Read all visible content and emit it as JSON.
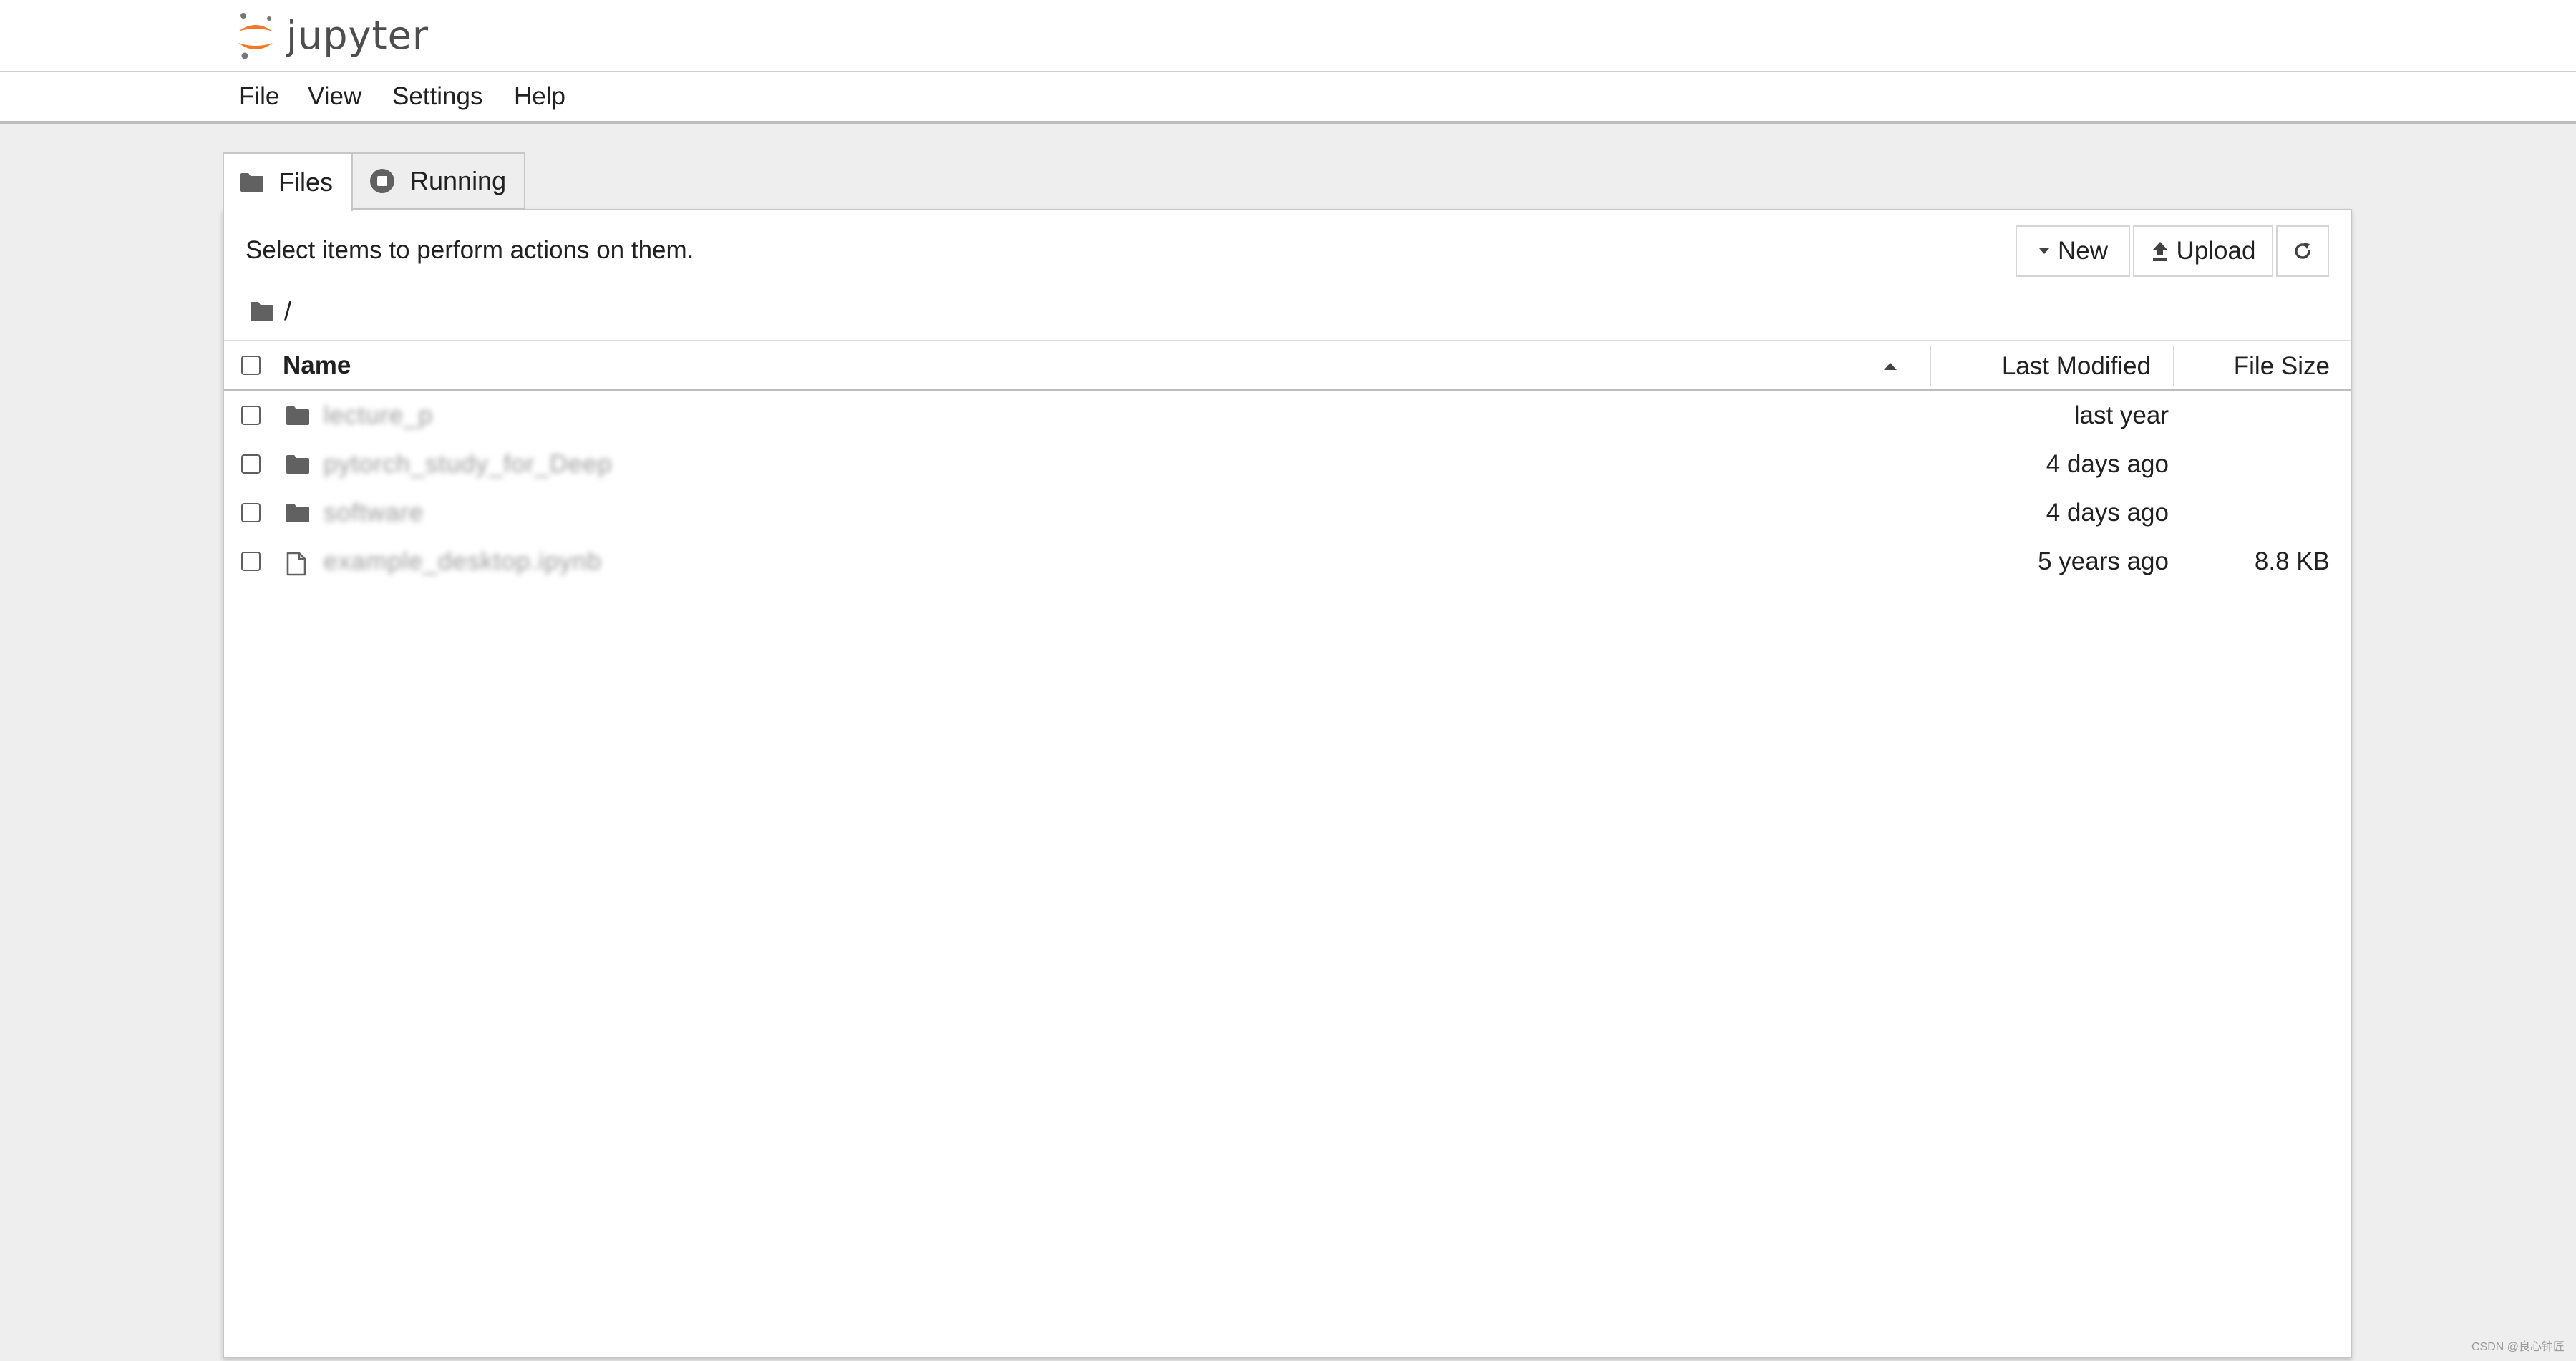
{
  "app": {
    "logo_text": "jupyter",
    "logo_colors": {
      "orange": "#F37726",
      "gray": "#767677"
    }
  },
  "menu": {
    "items": [
      {
        "label": "File"
      },
      {
        "label": "View"
      },
      {
        "label": "Settings"
      },
      {
        "label": "Help"
      }
    ]
  },
  "tabs": [
    {
      "label": "Files",
      "icon": "folder-icon",
      "active": true
    },
    {
      "label": "Running",
      "icon": "stop-circle-icon",
      "active": false
    }
  ],
  "filebrowser": {
    "instructions": "Select items to perform actions on them.",
    "buttons": {
      "new_label": "New",
      "upload_label": "Upload",
      "refresh_icon": "refresh-icon"
    },
    "breadcrumb": {
      "path": "/",
      "icon": "folder-icon"
    },
    "columns": {
      "name": "Name",
      "last_modified": "Last Modified",
      "file_size": "File Size",
      "sort": "ascending"
    },
    "rows": [
      {
        "type": "folder",
        "name": "lecture_p",
        "modified": "last year",
        "size": ""
      },
      {
        "type": "folder",
        "name": "pytorch_study_for_Deep",
        "modified": "4 days ago",
        "size": ""
      },
      {
        "type": "folder",
        "name": "software",
        "modified": "4 days ago",
        "size": ""
      },
      {
        "type": "file",
        "name": "example_desktop.ipynb",
        "modified": "5 years ago",
        "size": "8.8 KB"
      }
    ]
  },
  "watermark": "CSDN @良心钟匠",
  "colors": {
    "page_background": "#eeeeee",
    "panel_background": "#ffffff",
    "border": "#c7c7c7",
    "text": "#212121",
    "icon": "#616161"
  }
}
